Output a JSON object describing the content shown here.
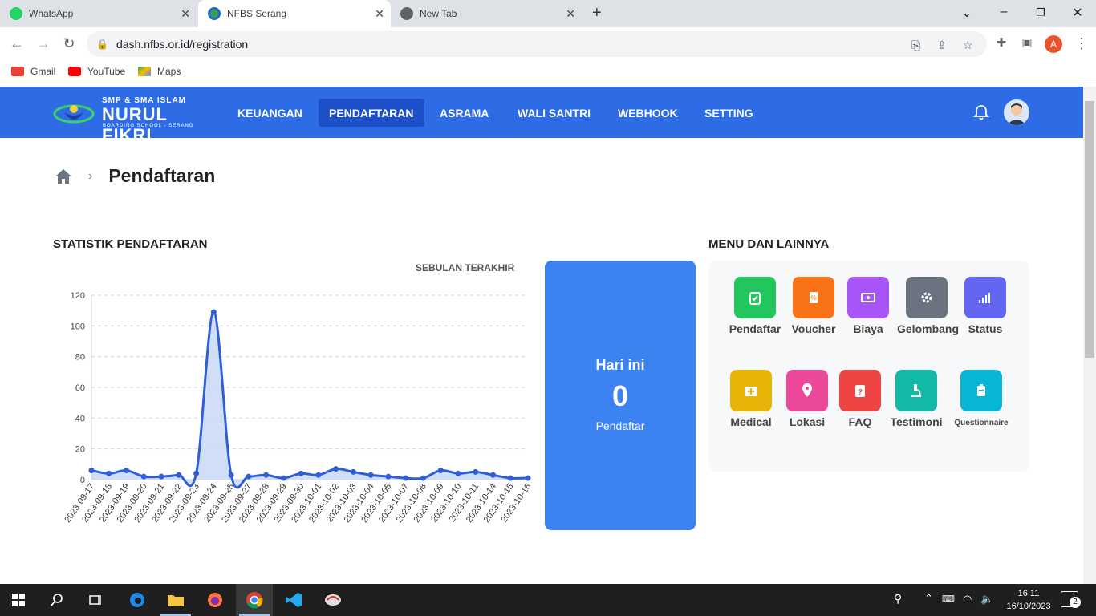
{
  "browser": {
    "tabs": [
      {
        "label": "WhatsApp",
        "icon": "whatsapp-icon"
      },
      {
        "label": "NFBS Serang",
        "icon": "nfbs-icon",
        "active": true
      },
      {
        "label": "New Tab",
        "icon": "globe-icon"
      }
    ],
    "url": "dash.nfbs.or.id/registration",
    "bookmarks": [
      {
        "label": "Gmail",
        "icon": "gmail-icon"
      },
      {
        "label": "YouTube",
        "icon": "youtube-icon"
      },
      {
        "label": "Maps",
        "icon": "maps-icon"
      }
    ],
    "profile_initial": "A"
  },
  "logo": {
    "line1": "SMP & SMA ISLAM",
    "line2": "NURUL FIKRI",
    "line3": "BOARDING SCHOOL - SERANG"
  },
  "nav": {
    "items": [
      {
        "label": "KEUANGAN"
      },
      {
        "label": "PENDAFTARAN",
        "active": true
      },
      {
        "label": "ASRAMA"
      },
      {
        "label": "WALI SANTRI"
      },
      {
        "label": "WEBHOOK"
      },
      {
        "label": "SETTING"
      }
    ]
  },
  "breadcrumb": {
    "title": "Pendaftaran"
  },
  "stats": {
    "title": "STATISTIK PENDAFTARAN",
    "range": "SEBULAN TERAKHIR"
  },
  "today": {
    "title": "Hari ini",
    "count": "0",
    "unit": "Pendaftar"
  },
  "menu": {
    "title": "MENU DAN LAINNYA",
    "items": [
      {
        "label": "Pendaftar",
        "color": "#22c55e",
        "icon": "clipboard-check-icon"
      },
      {
        "label": "Voucher",
        "color": "#f97316",
        "icon": "voucher-icon"
      },
      {
        "label": "Biaya",
        "color": "#a855f7",
        "icon": "money-icon"
      },
      {
        "label": "Gelombang",
        "color": "#6b7280",
        "icon": "gear-icon"
      },
      {
        "label": "Status",
        "color": "#6366f1",
        "icon": "signal-icon"
      },
      {
        "label": "Medical",
        "color": "#eab308",
        "icon": "medical-kit-icon"
      },
      {
        "label": "Lokasi",
        "color": "#ec4899",
        "icon": "map-pin-icon"
      },
      {
        "label": "FAQ",
        "color": "#ef4444",
        "icon": "question-icon"
      },
      {
        "label": "Testimoni",
        "color": "#14b8a6",
        "icon": "microscope-icon"
      },
      {
        "label": "Questionnaire",
        "color": "#06b6d4",
        "icon": "clipboard-icon"
      }
    ]
  },
  "taskbar": {
    "time": "16:11",
    "date": "16/10/2023",
    "notifications": "2"
  },
  "chart_data": {
    "type": "area",
    "xlabel": "",
    "ylabel": "",
    "ylim": [
      0,
      120
    ],
    "yticks": [
      0,
      20,
      40,
      60,
      80,
      100,
      120
    ],
    "grid": true,
    "color": "#2e5fd8",
    "x": [
      "2023-09-17",
      "2023-09-18",
      "2023-09-19",
      "2023-09-20",
      "2023-09-21",
      "2023-09-22",
      "2023-09-23",
      "2023-09-24",
      "2023-09-25",
      "2023-09-27",
      "2023-09-28",
      "2023-09-29",
      "2023-09-30",
      "2023-10-01",
      "2023-10-02",
      "2023-10-03",
      "2023-10-04",
      "2023-10-05",
      "2023-10-07",
      "2023-10-08",
      "2023-10-09",
      "2023-10-10",
      "2023-10-11",
      "2023-10-14",
      "2023-10-15",
      "2023-10-16"
    ],
    "values": [
      6,
      4,
      6,
      2,
      2,
      3,
      4,
      109,
      3,
      2,
      3,
      1,
      4,
      3,
      7,
      5,
      3,
      2,
      1,
      1,
      6,
      4,
      5,
      3,
      1,
      1
    ]
  }
}
